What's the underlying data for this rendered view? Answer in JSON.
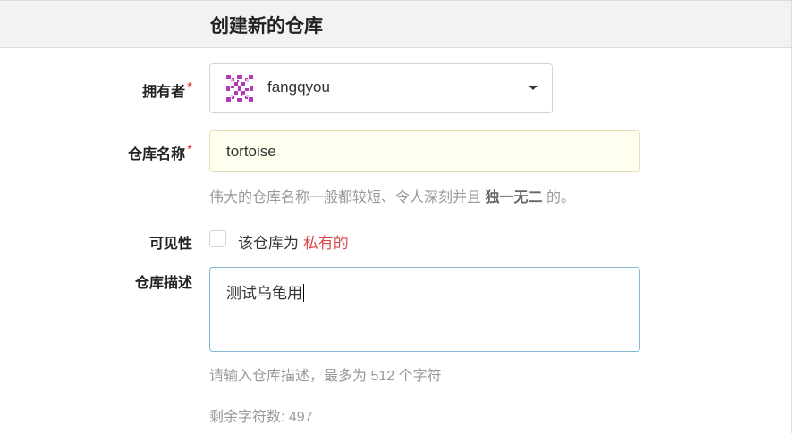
{
  "header": {
    "title": "创建新的仓库"
  },
  "form": {
    "owner": {
      "label": "拥有者",
      "required_mark": "*",
      "value": "fangqyou"
    },
    "repo_name": {
      "label": "仓库名称",
      "required_mark": "*",
      "value": "tortoise",
      "help_prefix": "伟大的仓库名称一般都较短、令人深刻并且",
      "help_emphasis": "独一无二",
      "help_suffix": "的。"
    },
    "visibility": {
      "label": "可见性",
      "checkbox_text": "该仓库为",
      "private_text": "私有的",
      "checked": false
    },
    "description": {
      "label": "仓库描述",
      "value": "测试乌龟用",
      "placeholder_hint": "请输入仓库描述，最多为 512 个字符",
      "remaining": "剩余字符数: 497"
    }
  },
  "colors": {
    "required": "#db2828",
    "private": "#db4b4b",
    "focus_border": "#85b7d9",
    "name_input_bg": "#fffff0",
    "avatar": "#b13bb4"
  },
  "icons": {
    "avatar": "identicon-avatar",
    "dropdown": "caret-down-icon"
  }
}
